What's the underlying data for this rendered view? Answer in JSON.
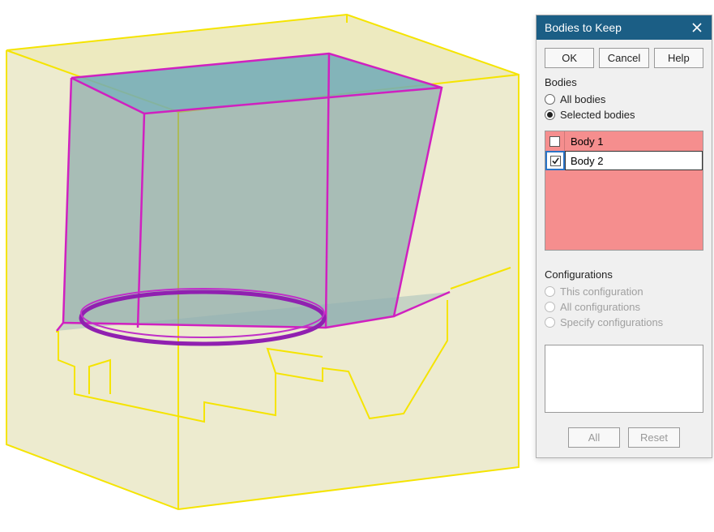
{
  "dialog": {
    "title": "Bodies to Keep",
    "buttons": {
      "ok": "OK",
      "cancel": "Cancel",
      "help": "Help"
    },
    "bodies_section": {
      "label": "Bodies",
      "radios": {
        "all": "All bodies",
        "selected": "Selected bodies"
      },
      "selected_radio": "selected",
      "items": [
        {
          "label": "Body  1",
          "checked": false,
          "active": false
        },
        {
          "label": "Body  2",
          "checked": true,
          "active": true
        }
      ]
    },
    "configurations_section": {
      "label": "Configurations",
      "radios": {
        "this": "This configuration",
        "all": "All configurations",
        "specify": "Specify configurations"
      },
      "enabled": false
    },
    "bottom_buttons": {
      "all": "All",
      "reset": "Reset"
    }
  },
  "colors": {
    "titlebar": "#1b5e85",
    "list_bg": "#f58e8e",
    "selection_outline": "#2b74c6"
  }
}
